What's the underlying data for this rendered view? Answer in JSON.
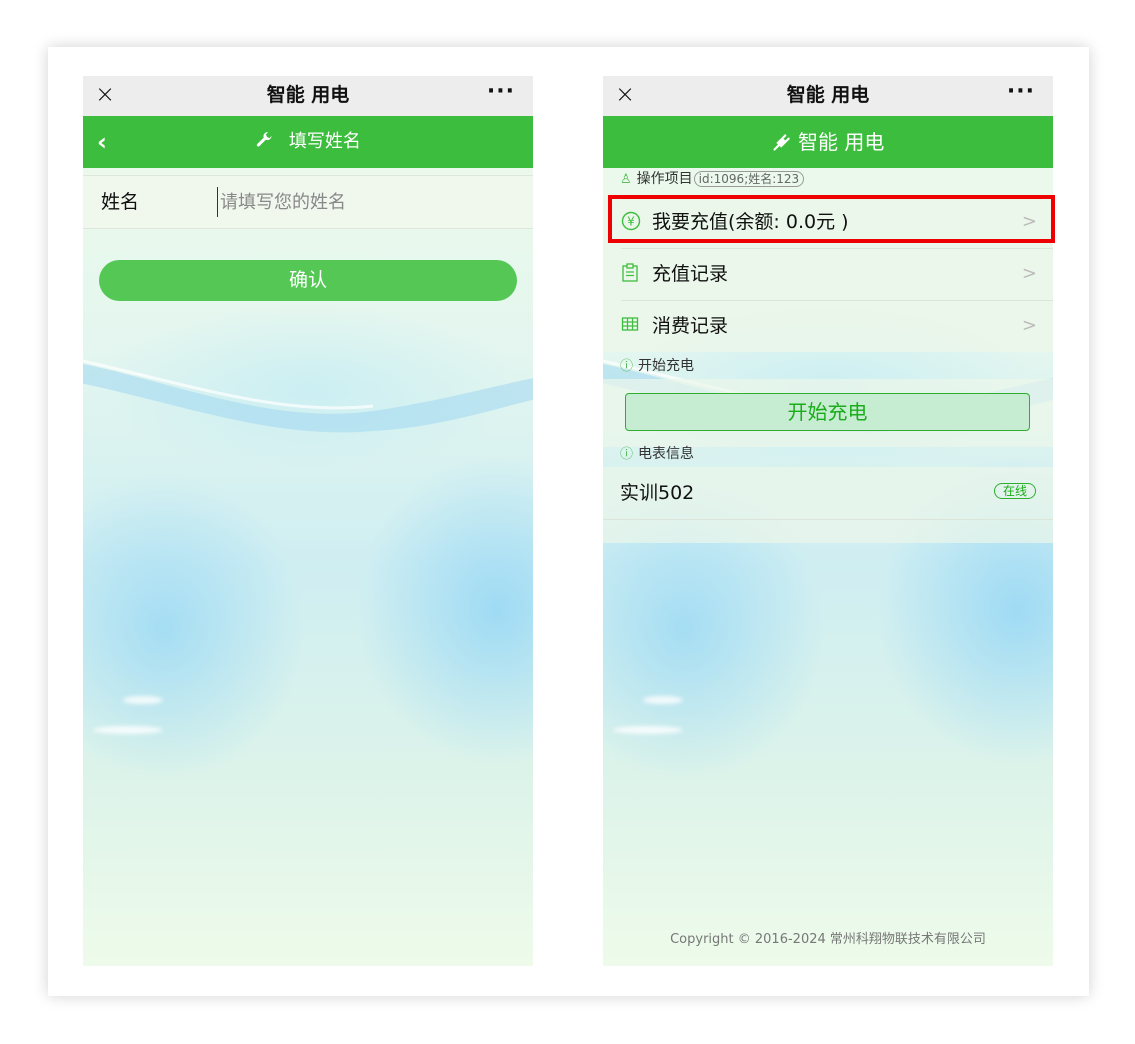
{
  "wechat_bar": {
    "title": "智能 用电",
    "close_icon": "×",
    "more_icon": "···"
  },
  "left_screen": {
    "header_title": "填写姓名",
    "back_icon": "‹",
    "header_icon": "🔧",
    "name_label": "姓名",
    "name_placeholder": "请填写您的姓名",
    "confirm_label": "确认"
  },
  "right_screen": {
    "header_title": "智能 用电",
    "header_icon": "🔌",
    "section_project": {
      "label": "操作项目",
      "badge": "id:1096;姓名:123"
    },
    "menu": [
      {
        "label": "我要充值(余额: 0.0元 )",
        "icon": "¥",
        "icon_name": "yen-circle-icon"
      },
      {
        "label": "充值记录",
        "icon": "▤",
        "icon_name": "clipboard-icon"
      },
      {
        "label": "消费记录",
        "icon": "▦",
        "icon_name": "table-icon"
      }
    ],
    "section_charge": {
      "label": "开始充电"
    },
    "start_button": "开始充电",
    "section_meter": {
      "label": "电表信息"
    },
    "meter": {
      "name": "实训502",
      "status": "在线"
    },
    "copyright": "Copyright © 2016-2024 常州科翔物联技术有限公司"
  },
  "colors": {
    "brand_green": "#3dbd3d",
    "highlight_red": "#ee0000"
  }
}
